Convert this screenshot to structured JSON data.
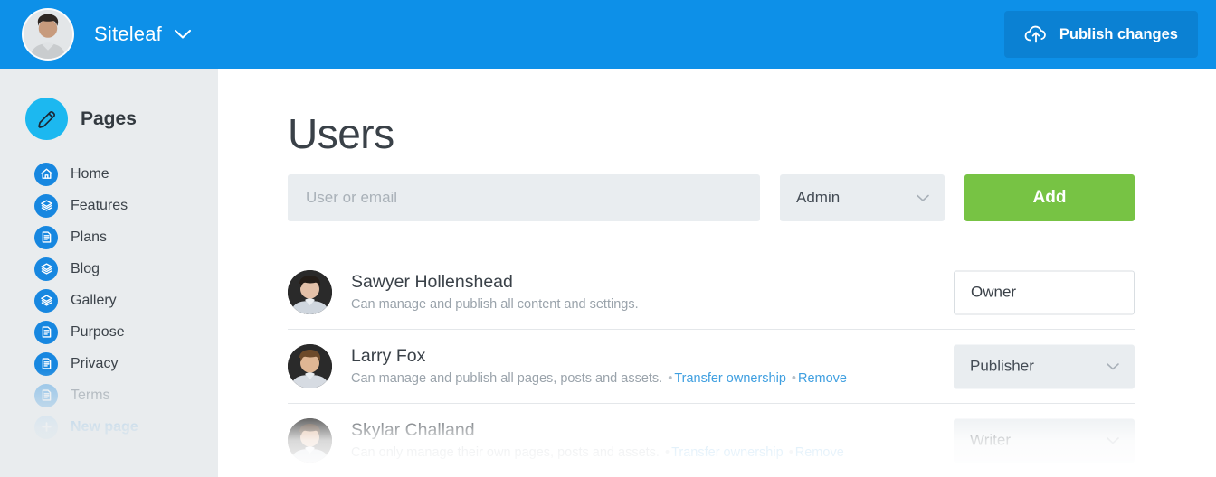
{
  "topbar": {
    "site_name": "Siteleaf",
    "site_chevron_icon": "chevron-down-icon",
    "user_avatar_icon": "user-avatar",
    "publish_label": "Publish changes",
    "publish_icon": "cloud-upload-icon",
    "bg_color": "#0d90e8",
    "publish_bg_color": "#0b81d3"
  },
  "sidebar": {
    "bg_color": "#e9ecee",
    "section": {
      "title": "Pages",
      "icon": "pencil-icon",
      "icon_color": "#1cb8f0"
    },
    "items": [
      {
        "label": "Home",
        "icon": "home-icon",
        "state": "normal"
      },
      {
        "label": "Features",
        "icon": "layers-icon",
        "state": "normal"
      },
      {
        "label": "Plans",
        "icon": "document-icon",
        "state": "normal"
      },
      {
        "label": "Blog",
        "icon": "layers-icon",
        "state": "normal"
      },
      {
        "label": "Gallery",
        "icon": "layers-icon",
        "state": "normal"
      },
      {
        "label": "Purpose",
        "icon": "document-icon",
        "state": "normal"
      },
      {
        "label": "Privacy",
        "icon": "document-icon",
        "state": "normal"
      },
      {
        "label": "Terms",
        "icon": "document-icon",
        "state": "muted"
      },
      {
        "label": "New page",
        "icon": "plus-icon",
        "state": "newpage"
      }
    ]
  },
  "main": {
    "title": "Users",
    "search": {
      "placeholder": "User or email",
      "value": ""
    },
    "role_select": {
      "value": "Admin",
      "chevron_icon": "chevron-down-icon"
    },
    "add_button": {
      "label": "Add",
      "color": "#77c344"
    },
    "users": [
      {
        "name": "Sawyer Hollenshead",
        "description": "Can manage and publish all content and settings.",
        "links": [],
        "role": "Owner",
        "role_editable": false,
        "avatar_icon": "user-avatar"
      },
      {
        "name": "Larry Fox",
        "description": "Can manage and publish all pages, posts and assets.",
        "links": [
          "Transfer ownership",
          "Remove"
        ],
        "role": "Publisher",
        "role_editable": true,
        "avatar_icon": "user-avatar"
      },
      {
        "name": "Skylar Challand",
        "description": "Can only manage their own pages, posts and assets.",
        "links": [
          "Transfer ownership",
          "Remove"
        ],
        "role": "Writer",
        "role_editable": true,
        "avatar_icon": "user-avatar"
      }
    ],
    "separator": "•",
    "link_color": "#3f9fe0"
  }
}
